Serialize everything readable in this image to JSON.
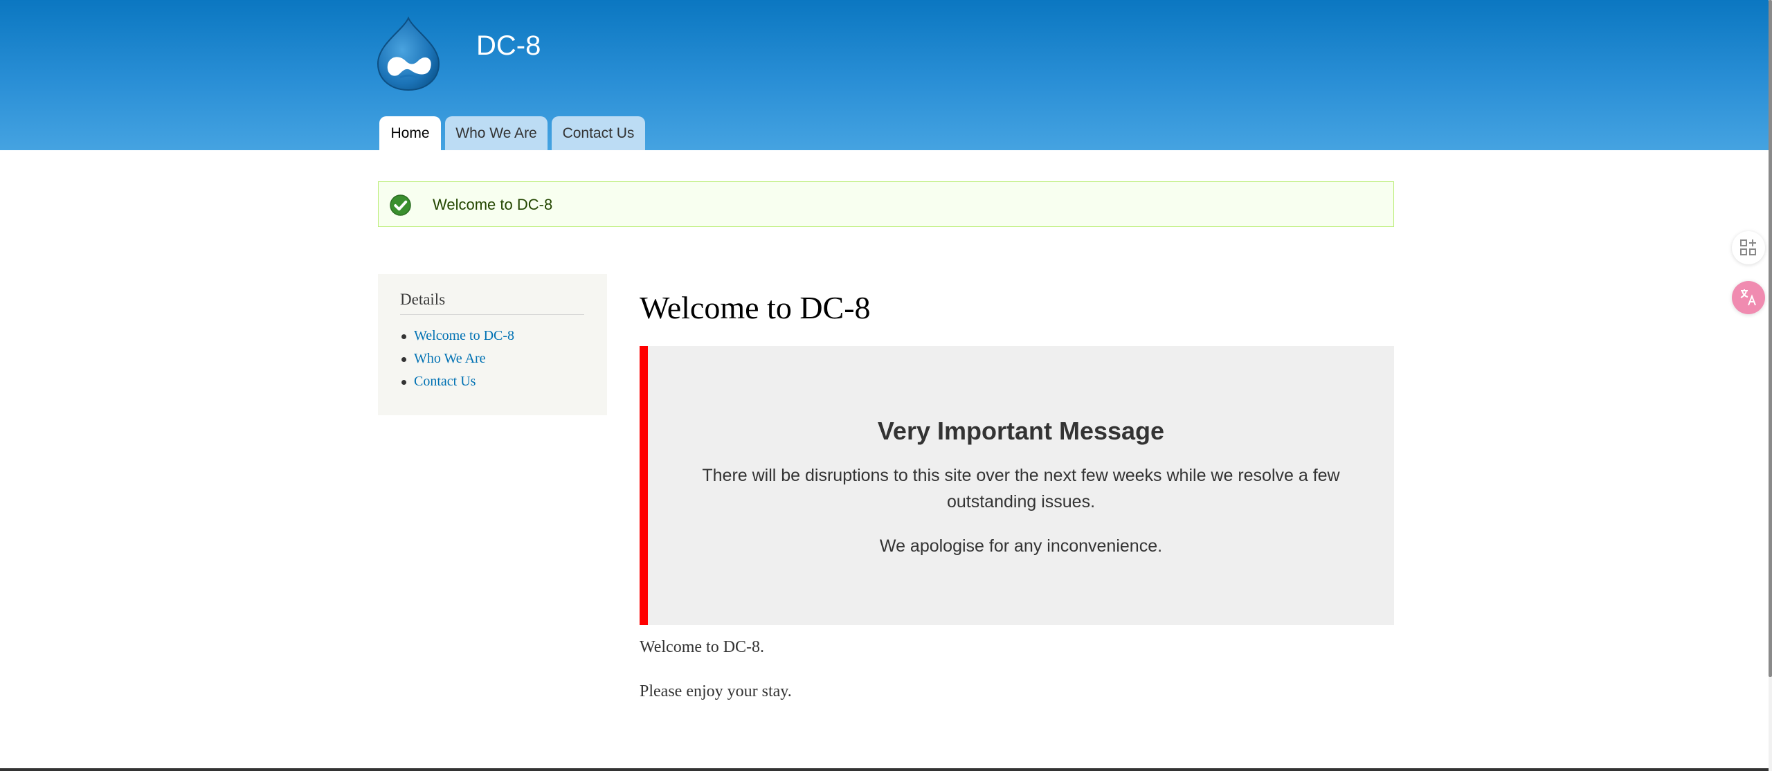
{
  "site": {
    "name": "DC-8"
  },
  "nav": {
    "tabs": [
      {
        "label": "Home",
        "active": true
      },
      {
        "label": "Who We Are",
        "active": false
      },
      {
        "label": "Contact Us",
        "active": false
      }
    ]
  },
  "status": {
    "message": "Welcome to DC-8"
  },
  "sidebar": {
    "title": "Details",
    "links": [
      {
        "label": "Welcome to DC-8"
      },
      {
        "label": "Who We Are"
      },
      {
        "label": "Contact Us"
      }
    ]
  },
  "main": {
    "title": "Welcome to DC-8",
    "notice": {
      "heading": "Very Important Message",
      "body": "There will be disruptions to this site over the next few weeks while we resolve a few outstanding issues.",
      "apology": "We apologise for any inconvenience."
    },
    "paragraphs": [
      "Welcome to DC-8.",
      "Please enjoy your stay."
    ]
  },
  "colors": {
    "header_top": "#0b77c1",
    "header_bottom": "#45a3e1",
    "link": "#0071b3",
    "notice_accent": "#ff0000",
    "status_bg": "#f8fff0",
    "status_border": "#bbee77"
  }
}
